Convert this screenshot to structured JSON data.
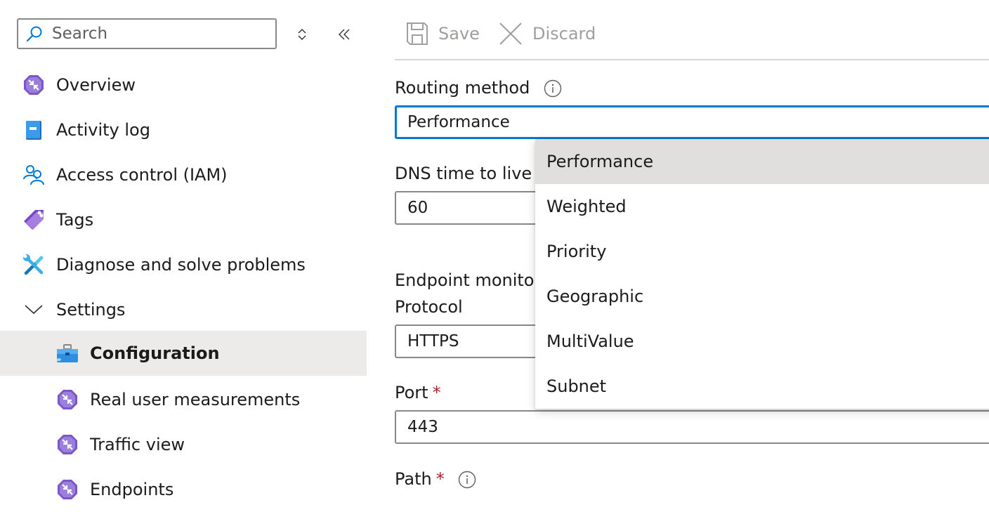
{
  "sidebar": {
    "search": {
      "placeholder": "Search",
      "value": ""
    },
    "collapse_expand_icon": "updown-diamond-icon",
    "collapse_sidebar_icon": "double-chevron-left-icon",
    "items": [
      {
        "label": "Overview",
        "icon": "traffic-manager-icon"
      },
      {
        "label": "Activity log",
        "icon": "activity-log-icon"
      },
      {
        "label": "Access control (IAM)",
        "icon": "people-icon"
      },
      {
        "label": "Tags",
        "icon": "tag-icon"
      },
      {
        "label": "Diagnose and solve problems",
        "icon": "wrench-screwdriver-icon"
      },
      {
        "label": "Settings",
        "icon": "chevron-down-icon",
        "expanded": true
      },
      {
        "label": "Configuration",
        "icon": "toolbox-icon",
        "selected": true
      },
      {
        "label": "Real user measurements",
        "icon": "traffic-manager-icon"
      },
      {
        "label": "Traffic view",
        "icon": "traffic-manager-icon"
      },
      {
        "label": "Endpoints",
        "icon": "traffic-manager-icon"
      }
    ]
  },
  "toolbar": {
    "save_label": "Save",
    "discard_label": "Discard"
  },
  "form": {
    "routing_method": {
      "label": "Routing method",
      "value": "Performance",
      "options": [
        "Performance",
        "Weighted",
        "Priority",
        "Geographic",
        "MultiValue",
        "Subnet"
      ],
      "selected_option": "Performance"
    },
    "dns_ttl": {
      "label": "DNS time to live (",
      "value": "60"
    },
    "endpoint_monitor": {
      "label": "Endpoint monitor"
    },
    "protocol": {
      "label": "Protocol",
      "value": "HTTPS"
    },
    "port": {
      "label": "Port",
      "required_mark": "*",
      "value": "443"
    },
    "path": {
      "label": "Path",
      "required_mark": "*"
    }
  },
  "colors": {
    "accent": "#0078d4",
    "required": "#a4262c",
    "selected_bg": "#edebe9",
    "option_selected_bg": "#e1dfdd",
    "disabled_text": "#a19f9d"
  }
}
